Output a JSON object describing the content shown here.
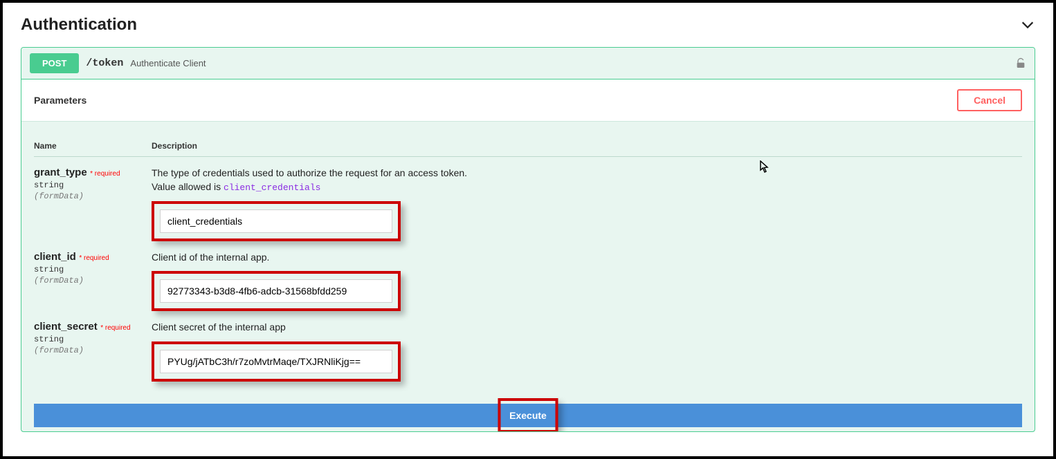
{
  "section_title": "Authentication",
  "endpoint": {
    "method": "POST",
    "path": "/token",
    "summary": "Authenticate Client"
  },
  "parameters_label": "Parameters",
  "cancel_label": "Cancel",
  "table": {
    "name_header": "Name",
    "desc_header": "Description"
  },
  "params": {
    "grant_type": {
      "name": "grant_type",
      "required": "* required",
      "type": "string",
      "in": "(formData)",
      "desc_line1": "The type of credentials used to authorize the request for an access token.",
      "desc_line2_prefix": "Value allowed is ",
      "desc_line2_code": "client_credentials",
      "value": "client_credentials"
    },
    "client_id": {
      "name": "client_id",
      "required": "* required",
      "type": "string",
      "in": "(formData)",
      "desc": "Client id of the internal app.",
      "value": "92773343-b3d8-4fb6-adcb-31568bfdd259"
    },
    "client_secret": {
      "name": "client_secret",
      "required": "* required",
      "type": "string",
      "in": "(formData)",
      "desc": "Client secret of the internal app",
      "value": "PYUg/jATbC3h/r7zoMvtrMaqe/TXJRNliKjg=="
    }
  },
  "execute_label": "Execute"
}
